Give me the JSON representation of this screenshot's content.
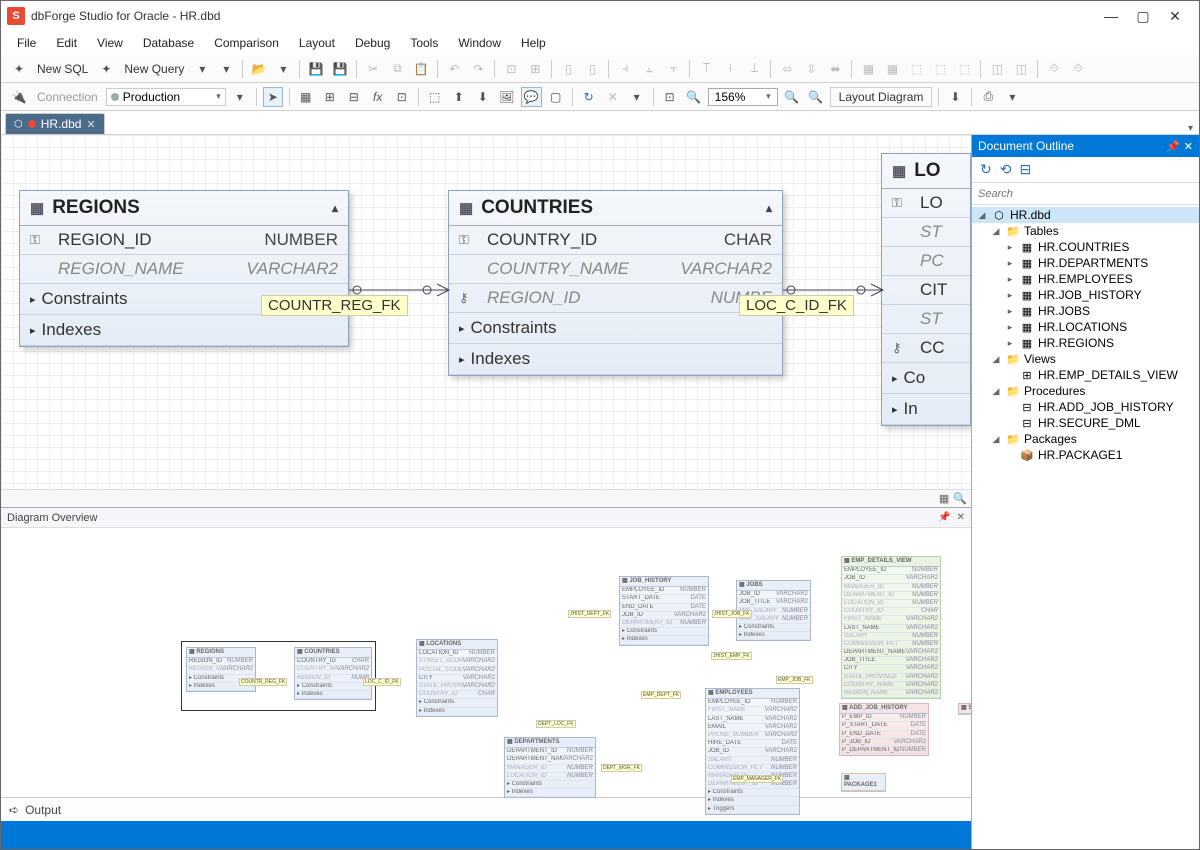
{
  "app": {
    "title": "dbForge Studio for Oracle - HR.dbd"
  },
  "menu": [
    "File",
    "Edit",
    "View",
    "Database",
    "Comparison",
    "Layout",
    "Debug",
    "Tools",
    "Window",
    "Help"
  ],
  "tb1": {
    "new_sql": "New SQL",
    "new_query": "New Query"
  },
  "tb2": {
    "connection_label": "Connection",
    "connection_value": "Production",
    "zoom": "156%",
    "layout_btn": "Layout Diagram"
  },
  "tab": {
    "name": "HR.dbd"
  },
  "entities": {
    "regions": {
      "title": "REGIONS",
      "cols": [
        {
          "icon": "key",
          "name": "REGION_ID",
          "type": "NUMBER",
          "faded": false
        },
        {
          "icon": "",
          "name": "REGION_NAME",
          "type": "VARCHAR2",
          "faded": true
        }
      ],
      "sections": [
        "Constraints",
        "Indexes"
      ]
    },
    "countries": {
      "title": "COUNTRIES",
      "cols": [
        {
          "icon": "key",
          "name": "COUNTRY_ID",
          "type": "CHAR",
          "faded": false
        },
        {
          "icon": "",
          "name": "COUNTRY_NAME",
          "type": "VARCHAR2",
          "faded": true
        },
        {
          "icon": "link",
          "name": "REGION_ID",
          "type": "NUMBE",
          "faded": true
        }
      ],
      "sections": [
        "Constraints",
        "Indexes"
      ]
    },
    "locations_partial": {
      "title": "LO",
      "rows": [
        "LO",
        "ST",
        "PC",
        "CIT",
        "ST",
        "CC"
      ],
      "sections": [
        "Co",
        "In"
      ]
    }
  },
  "fk_labels": {
    "reg": "COUNTR_REG_FK",
    "loc": "LOC_C_ID_FK"
  },
  "outline": {
    "title": "Document Outline",
    "search_placeholder": "Search",
    "root": "HR.dbd",
    "tables_label": "Tables",
    "tables": [
      "HR.COUNTRIES",
      "HR.DEPARTMENTS",
      "HR.EMPLOYEES",
      "HR.JOB_HISTORY",
      "HR.JOBS",
      "HR.LOCATIONS",
      "HR.REGIONS"
    ],
    "views_label": "Views",
    "views": [
      "HR.EMP_DETAILS_VIEW"
    ],
    "procs_label": "Procedures",
    "procs": [
      "HR.ADD_JOB_HISTORY",
      "HR.SECURE_DML"
    ],
    "pkgs_label": "Packages",
    "pkgs": [
      "HR.PACKAGE1"
    ]
  },
  "overview": {
    "title": "Diagram Overview"
  },
  "mini": {
    "regions": {
      "title": "REGIONS",
      "rows": [
        [
          "REGION_ID",
          "NUMBER",
          false
        ],
        [
          "REGION_NAME",
          "VARCHAR2",
          true
        ]
      ],
      "sec": [
        "Constraints",
        "Indexes"
      ]
    },
    "countries": {
      "title": "COUNTRIES",
      "rows": [
        [
          "COUNTRY_ID",
          "CHAR",
          false
        ],
        [
          "COUNTRY_NAME",
          "VARCHAR2",
          true
        ],
        [
          "REGION_ID",
          "NUMB",
          true
        ]
      ],
      "sec": [
        "Constraints",
        "Indexes"
      ]
    },
    "locations": {
      "title": "LOCATIONS",
      "rows": [
        [
          "LOCATION_ID",
          "NUMBER",
          false
        ],
        [
          "STREET_ADDRESS",
          "VARCHAR2",
          true
        ],
        [
          "POSTAL_CODE",
          "VARCHAR2",
          true
        ],
        [
          "CITY",
          "VARCHAR2",
          false
        ],
        [
          "STATE_PROVINCE",
          "VARCHAR2",
          true
        ],
        [
          "COUNTRY_ID",
          "CHAR",
          true
        ]
      ],
      "sec": [
        "Constraints",
        "Indexes"
      ]
    },
    "job_history": {
      "title": "JOB_HISTORY",
      "rows": [
        [
          "EMPLOYEE_ID",
          "NUMBER",
          false
        ],
        [
          "START_DATE",
          "DATE",
          false
        ],
        [
          "END_DATE",
          "DATE",
          false
        ],
        [
          "JOB_ID",
          "VARCHAR2",
          false
        ],
        [
          "DEPARTMENT_ID",
          "NUMBER",
          true
        ]
      ],
      "sec": [
        "Constraints",
        "Indexes"
      ]
    },
    "jobs": {
      "title": "JOBS",
      "rows": [
        [
          "JOB_ID",
          "VARCHAR2",
          false
        ],
        [
          "JOB_TITLE",
          "VARCHAR2",
          false
        ],
        [
          "MIN_SALARY",
          "NUMBER",
          true
        ],
        [
          "MAX_SALARY",
          "NUMBER",
          true
        ]
      ],
      "sec": [
        "Constraints",
        "Indexes"
      ]
    },
    "departments": {
      "title": "DEPARTMENTS",
      "rows": [
        [
          "DEPARTMENT_ID",
          "NUMBER",
          false
        ],
        [
          "DEPARTMENT_NAME",
          "VARCHAR2",
          false
        ],
        [
          "MANAGER_ID",
          "NUMBER",
          true
        ],
        [
          "LOCATION_ID",
          "NUMBER",
          true
        ]
      ],
      "sec": [
        "Constraints",
        "Indexes"
      ]
    },
    "employees": {
      "title": "EMPLOYEES",
      "rows": [
        [
          "EMPLOYEE_ID",
          "NUMBER",
          false
        ],
        [
          "FIRST_NAME",
          "VARCHAR2",
          true
        ],
        [
          "LAST_NAME",
          "VARCHAR2",
          false
        ],
        [
          "EMAIL",
          "VARCHAR2",
          false
        ],
        [
          "PHONE_NUMBER",
          "VARCHAR2",
          true
        ],
        [
          "HIRE_DATE",
          "DATE",
          false
        ],
        [
          "JOB_ID",
          "VARCHAR2",
          false
        ],
        [
          "SALARY",
          "NUMBER",
          true
        ],
        [
          "COMMISSION_PCT",
          "NUMBER",
          true
        ],
        [
          "MANAGER_ID",
          "NUMBER",
          true
        ],
        [
          "DEPARTMENT_ID",
          "NUMBER",
          true
        ]
      ],
      "sec": [
        "Constraints",
        "Indexes",
        "Triggers"
      ]
    },
    "emp_details": {
      "title": "EMP_DETAILS_VIEW",
      "rows": [
        [
          "EMPLOYEE_ID",
          "NUMBER",
          false
        ],
        [
          "JOB_ID",
          "VARCHAR2",
          false
        ],
        [
          "MANAGER_ID",
          "NUMBER",
          true
        ],
        [
          "DEPARTMENT_ID",
          "NUMBER",
          true
        ],
        [
          "LOCATION_ID",
          "NUMBER",
          true
        ],
        [
          "COUNTRY_ID",
          "CHAR",
          true
        ],
        [
          "FIRST_NAME",
          "VARCHAR2",
          true
        ],
        [
          "LAST_NAME",
          "VARCHAR2",
          false
        ],
        [
          "SALARY",
          "NUMBER",
          true
        ],
        [
          "COMMISSION_PCT",
          "NUMBER",
          true
        ],
        [
          "DEPARTMENT_NAME",
          "VARCHAR2",
          false
        ],
        [
          "JOB_TITLE",
          "VARCHAR2",
          false
        ],
        [
          "CITY",
          "VARCHAR2",
          false
        ],
        [
          "STATE_PROVINCE",
          "VARCHAR2",
          true
        ],
        [
          "COUNTRY_NAME",
          "VARCHAR2",
          true
        ],
        [
          "REGION_NAME",
          "VARCHAR2",
          true
        ]
      ]
    },
    "add_job": {
      "title": "ADD_JOB_HISTORY",
      "rows": [
        [
          "P_EMP_ID",
          "NUMBER",
          false
        ],
        [
          "P_START_DATE",
          "DATE",
          false
        ],
        [
          "P_END_DATE",
          "DATE",
          false
        ],
        [
          "P_JOB_ID",
          "VARCHAR2",
          false
        ],
        [
          "P_DEPARTMENT_ID",
          "NUMBER",
          false
        ]
      ]
    },
    "secure": {
      "title": "SECURE_DML"
    },
    "package": {
      "title": "PACKAGE1"
    },
    "fk": {
      "reg": "COUNTR_REG_FK",
      "loc": "LOC_C_ID_FK",
      "jdept": "JHIST_DEPT_FK",
      "jjob": "JHIST_JOB_FK",
      "jemp": "JHIST_EMP_FK",
      "ejob": "EMP_JOB_FK",
      "edept": "EMP_DEPT_FK",
      "dloc": "DEPT_LOC_FK",
      "dmgr": "DEPT_MGR_FK",
      "emgr": "EMP_MANAGER_FK"
    }
  },
  "output": {
    "label": "Output"
  }
}
